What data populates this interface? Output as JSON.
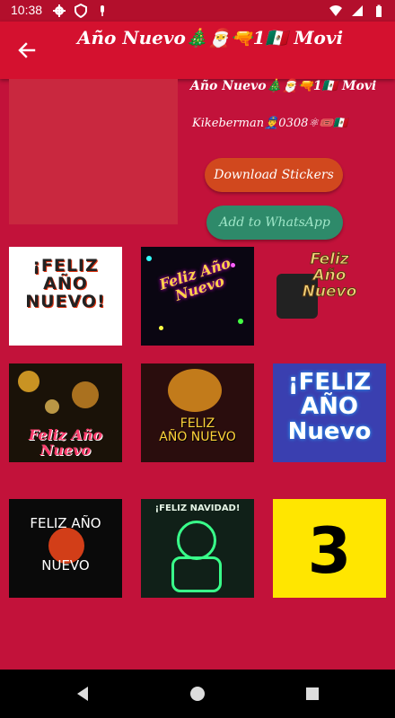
{
  "status_bar": {
    "time": "10:38",
    "icons_left": [
      "settings-gear-icon",
      "shield-icon",
      "microphone-icon"
    ],
    "icons_right": [
      "wifi-icon",
      "signal-icon",
      "battery-icon"
    ]
  },
  "app_bar": {
    "title": "Año Nuevo🎄🎅🔫1🇲🇽 Movi",
    "back_icon": "arrow-back-icon"
  },
  "pack": {
    "name": "Año Nuevo🎄🎅🔫1🇲🇽 Movi",
    "author": "Kikeberman👮‍♂️0308⚛🎟️🇲🇽",
    "download_label": "Download Stickers",
    "whatsapp_label": "Add to WhatsApp"
  },
  "stickers": [
    {
      "text": "¡FELIZ\nAÑO\nNUEVO!"
    },
    {
      "text": "Feliz Año\nNuevo"
    },
    {
      "text": "Feliz\nAño\nNuevo"
    },
    {
      "text": "Feliz Año\nNuevo"
    },
    {
      "text": "FELIZ\nAÑO NUEVO"
    },
    {
      "text": "¡FELIZ\nAÑO\nNuevo"
    },
    {
      "text": "FELIZ AÑO\n\n\nNUEVO"
    },
    {
      "text": "¡FELIZ NAVIDAD!"
    },
    {
      "text": "3"
    }
  ],
  "colors": {
    "background": "#c2123a",
    "app_bar": "#d4112f",
    "download_button": "#d1481e",
    "whatsapp_button": "#2e8a6a"
  },
  "nav_bar": {
    "icons": [
      "nav-back-icon",
      "nav-home-icon",
      "nav-recents-icon"
    ]
  }
}
